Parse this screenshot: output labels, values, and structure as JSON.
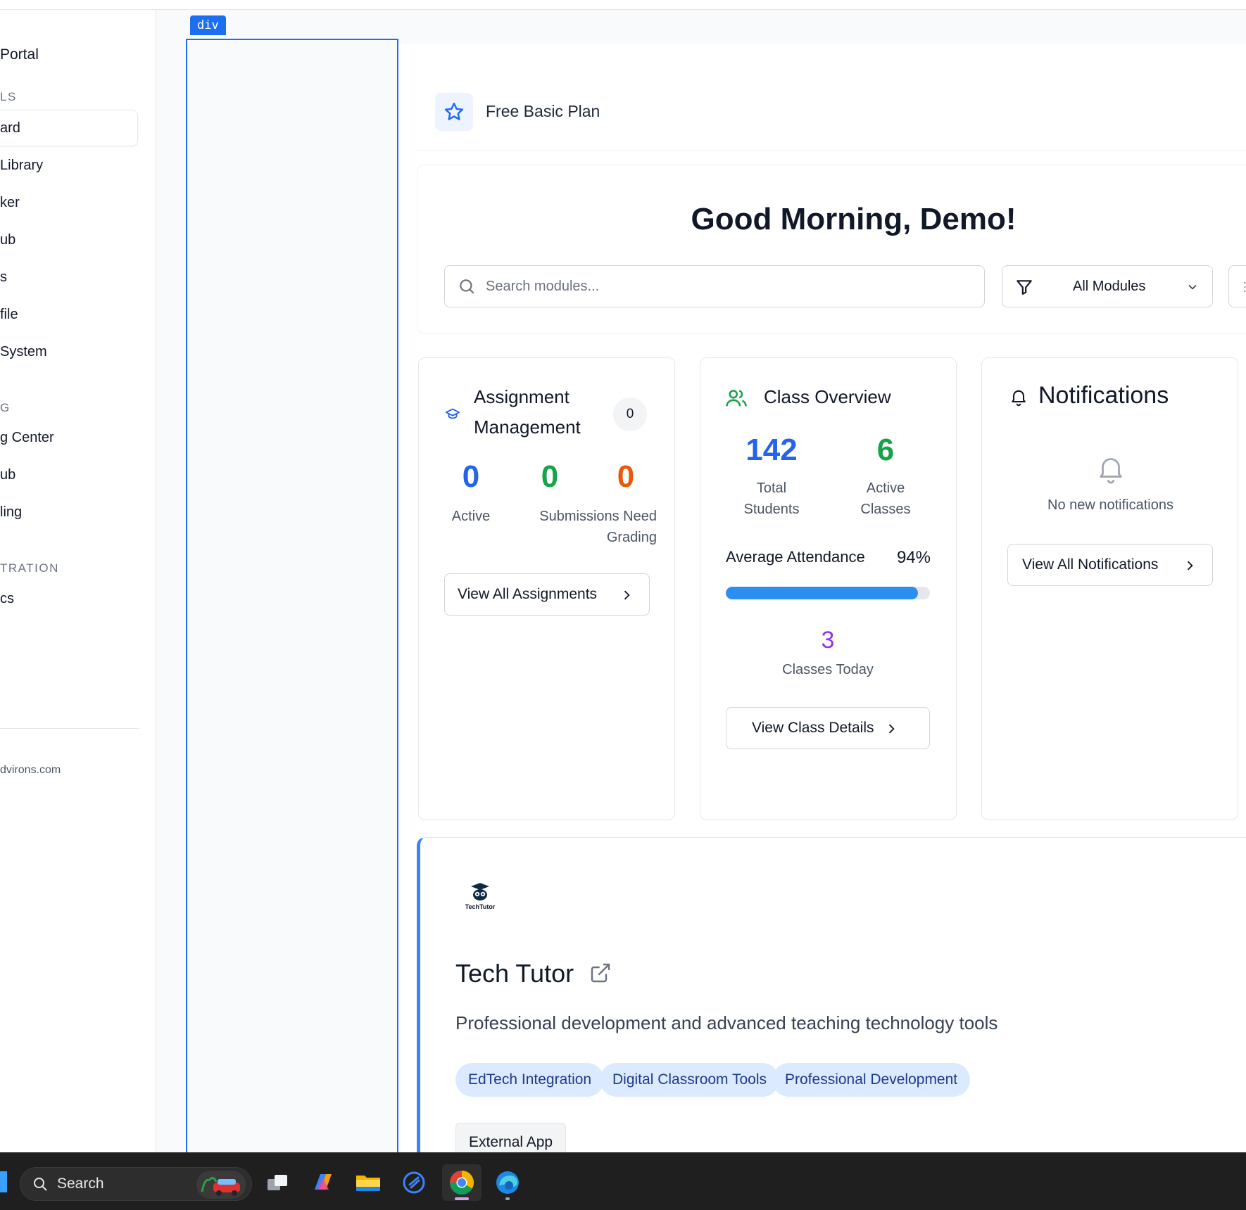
{
  "sidebar": {
    "title": "Portal",
    "sections": [
      {
        "label": "LS"
      },
      {
        "label": "G"
      },
      {
        "label": "TRATION"
      }
    ],
    "items": [
      {
        "label": "ard"
      },
      {
        "label": "Library"
      },
      {
        "label": "ker"
      },
      {
        "label": "ub"
      },
      {
        "label": "s"
      },
      {
        "label": "file"
      },
      {
        "label": "System"
      },
      {
        "label": "g Center"
      },
      {
        "label": "ub"
      },
      {
        "label": "ling"
      },
      {
        "label": "cs"
      }
    ],
    "footer_email": "dvirons.com"
  },
  "inspector": {
    "tag_label": "div"
  },
  "plan": {
    "label": "Free Basic Plan",
    "icon": "star-icon"
  },
  "greeting": "Good Morning, Demo!",
  "search": {
    "placeholder": "Search modules..."
  },
  "filter": {
    "selected": "All Modules"
  },
  "assignments": {
    "title": "Assignment Management",
    "title_line1": "Assignment",
    "title_line2": "Management",
    "badge": "0",
    "stats": [
      {
        "value": "0",
        "label": "Active",
        "color": "#2563eb"
      },
      {
        "value": "0",
        "label": "Submissions Need Grading",
        "color": "#16a34a"
      },
      {
        "value": "0",
        "label": "",
        "color": "#ea580c"
      }
    ],
    "button": "View All Assignments"
  },
  "class_overview": {
    "title": "Class Overview",
    "total_students": "142",
    "total_students_label_1": "Total",
    "total_students_label_2": "Students",
    "active_classes": "6",
    "active_classes_label_1": "Active",
    "active_classes_label_2": "Classes",
    "attendance_label": "Average Attendance",
    "attendance_value": "94%",
    "attendance_fraction": 0.94,
    "classes_today": "3",
    "classes_today_label": "Classes Today",
    "button": "View Class Details",
    "colors": {
      "students": "#2563eb",
      "classes": "#16a34a",
      "today": "#9333ea",
      "bar": "#2b8ef0"
    }
  },
  "notifications": {
    "title": "Notifications",
    "empty_text": "No new notifications",
    "button": "View All Notifications"
  },
  "app": {
    "logo_text": "TechTutor",
    "title": "Tech Tutor",
    "description": "Professional development and advanced teaching technology tools",
    "tags": [
      "EdTech Integration",
      "Digital Classroom Tools",
      "Professional Development"
    ],
    "type_label": "External App"
  },
  "taskbar": {
    "search_label": "Search",
    "apps": [
      "task-view-icon",
      "copilot-icon",
      "file-explorer-icon",
      "quick-assist-icon",
      "chrome-icon",
      "edge-icon"
    ]
  }
}
